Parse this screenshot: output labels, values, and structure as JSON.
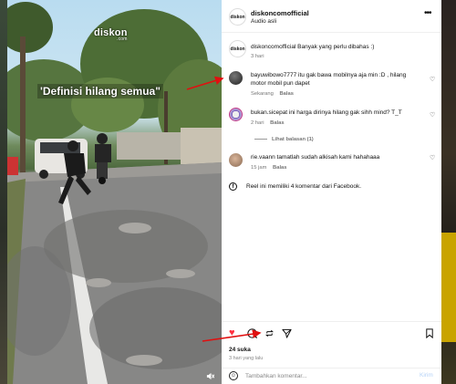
{
  "photo": {
    "watermark": "diskon",
    "watermark_sub": ".com",
    "caption": "'Definisi hilang semua\"",
    "mute_icon": "speaker-muted-icon"
  },
  "header": {
    "avatar_text": "diskon",
    "username": "diskoncomofficial",
    "audio": "Audio asli",
    "more_icon": "more-horizontal-icon"
  },
  "caption_post": {
    "text": "diskoncomofficial Banyak yang perlu dibahas :)",
    "time": "3 hari"
  },
  "comments": [
    {
      "text": "bayuwibowo7777 itu gak bawa mobilnya aja min :D , hilang motor mobil pun dapet",
      "time": "Sekarang",
      "reply": "Balas"
    },
    {
      "text": "bukan.sicepat ini harga dirinya hilang gak sihh mind? T_T",
      "time": "2 hari",
      "reply": "Balas"
    },
    {
      "text": "rie.vaann tamatlah sudah alkisah kami hahahaaa",
      "time": "15 jam",
      "reply": "Balas"
    }
  ],
  "view_replies": "Lihat balasan (1)",
  "fb_note": "Reel ini memiliki 4 komentar dari Facebook.",
  "actions": {
    "likes": "24 suka",
    "when": "3 hari yang lalu"
  },
  "composer": {
    "placeholder": "Tambahkan komentar...",
    "send": "Kirim"
  },
  "colors": {
    "like_red": "#ff3040",
    "annotation_red": "#e01010",
    "send_disabled": "#b4d2f7"
  }
}
